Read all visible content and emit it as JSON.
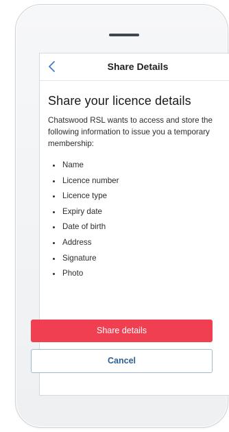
{
  "nav": {
    "title": "Share Details",
    "back_icon": "chevron-left-icon"
  },
  "content": {
    "heading": "Share your licence details",
    "intro": "Chatswood RSL wants to access and store the following information to issue you a temporary membership:",
    "items": [
      "Name",
      "Licence number",
      "Licence type",
      "Expiry date",
      "Date of birth",
      "Address",
      "Signature",
      "Photo"
    ]
  },
  "actions": {
    "share_label": "Share details",
    "cancel_label": "Cancel"
  },
  "colors": {
    "accent": "#ef3f51",
    "link": "#2b5f93",
    "back_chevron": "#3a7bd5"
  }
}
